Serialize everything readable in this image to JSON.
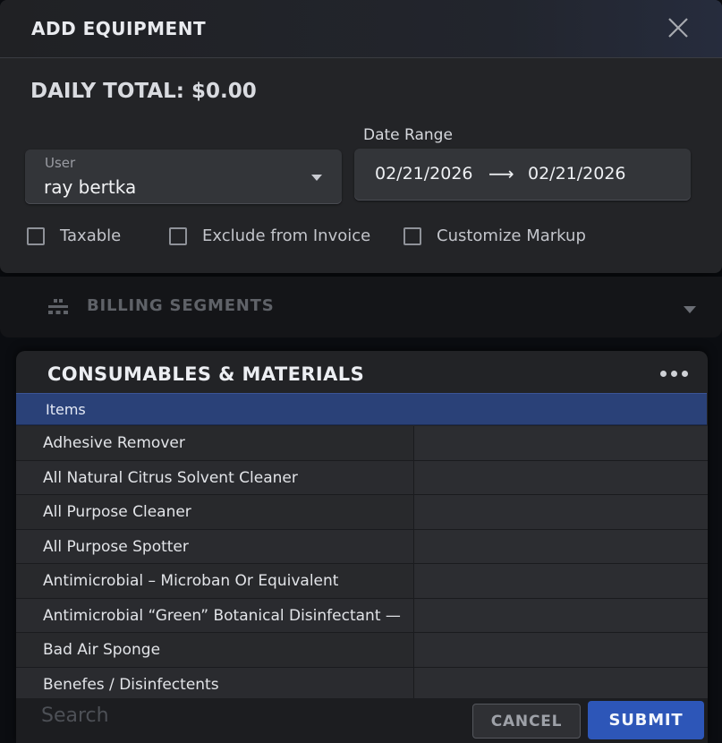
{
  "dialog": {
    "title": "ADD EQUIPMENT",
    "daily_total": "DAILY TOTAL: $0.00",
    "close_icon": "close-icon"
  },
  "user_field": {
    "label": "User",
    "value": "ray bertka"
  },
  "date_range": {
    "label": "Date Range",
    "start": "02/21/2026",
    "arrow": "⟶",
    "end": "02/21/2026"
  },
  "checkboxes": [
    {
      "label": "Taxable",
      "checked": false
    },
    {
      "label": "Exclude from Invoice",
      "checked": false
    },
    {
      "label": "Customize Markup",
      "checked": false
    }
  ],
  "billing": {
    "label": "BILLING SEGMENTS",
    "icon": "segments-icon"
  },
  "panel": {
    "title": "CONSUMABLES & MATERIALS",
    "more_icon": "more-horizontal-icon",
    "list_header": "Items",
    "items": [
      "Adhesive Remover",
      "All Natural Citrus Solvent Cleaner",
      "All Purpose Cleaner",
      "All Purpose Spotter",
      "Antimicrobial – Microban Or Equivalent",
      "Antimicrobial “Green” Botanical Disinfectant —",
      "Bad Air Sponge",
      "Benefes / Disinfectents"
    ]
  },
  "footer": {
    "search_placeholder": "Search",
    "cancel_label": "CANCEL",
    "submit_label": "SUBMIT"
  },
  "colors": {
    "accent": "#2d56b8",
    "selected_row": "#2a4178",
    "background": "#232427"
  }
}
